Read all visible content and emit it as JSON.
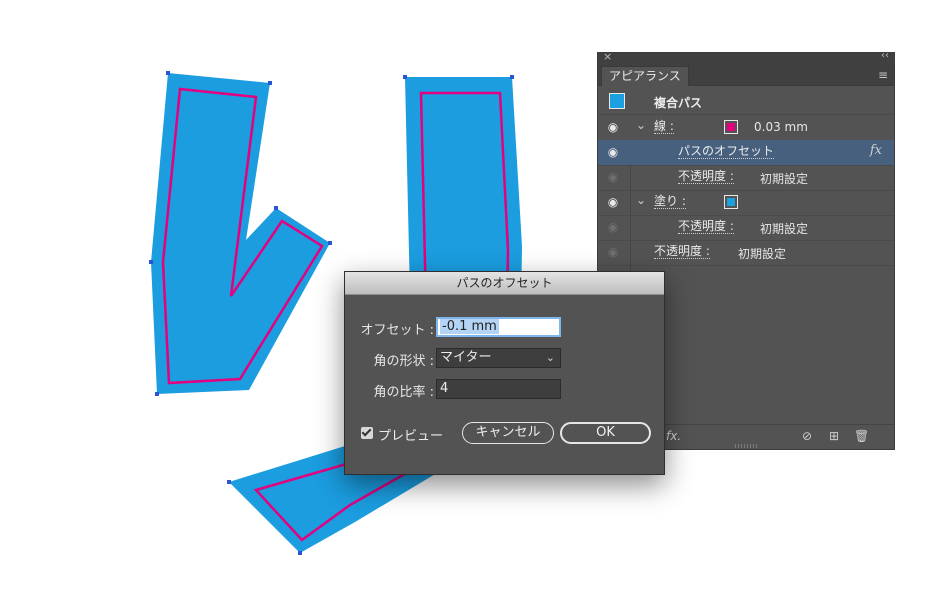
{
  "colors": {
    "artwork_fill": "#1b9de0",
    "artwork_stroke": "#e4007f",
    "anchor": "#2b53d6"
  },
  "panel": {
    "tab_label": "アピアランス",
    "object_title": "複合パス",
    "rows": {
      "stroke_label": "線 :",
      "stroke_value": "0.03 mm",
      "offset_effect_label": "パスのオフセット",
      "fx_label": "fx",
      "stroke_opacity_label": "不透明度 :",
      "stroke_opacity_value": "初期設定",
      "fill_label": "塗り :",
      "fill_opacity_label": "不透明度 :",
      "fill_opacity_value": "初期設定",
      "object_opacity_label": "不透明度 :",
      "object_opacity_value": "初期設定"
    },
    "bottom_fx": "fx."
  },
  "dialog": {
    "title": "パスのオフセット",
    "offset_label": "オフセット :",
    "offset_value": "-0.1 mm",
    "join_label": "角の形状 :",
    "join_value": "マイター",
    "miter_label": "角の比率 :",
    "miter_value": "4",
    "preview_label": "プレビュー",
    "preview_checked": true,
    "cancel_label": "キャンセル",
    "ok_label": "OK"
  }
}
